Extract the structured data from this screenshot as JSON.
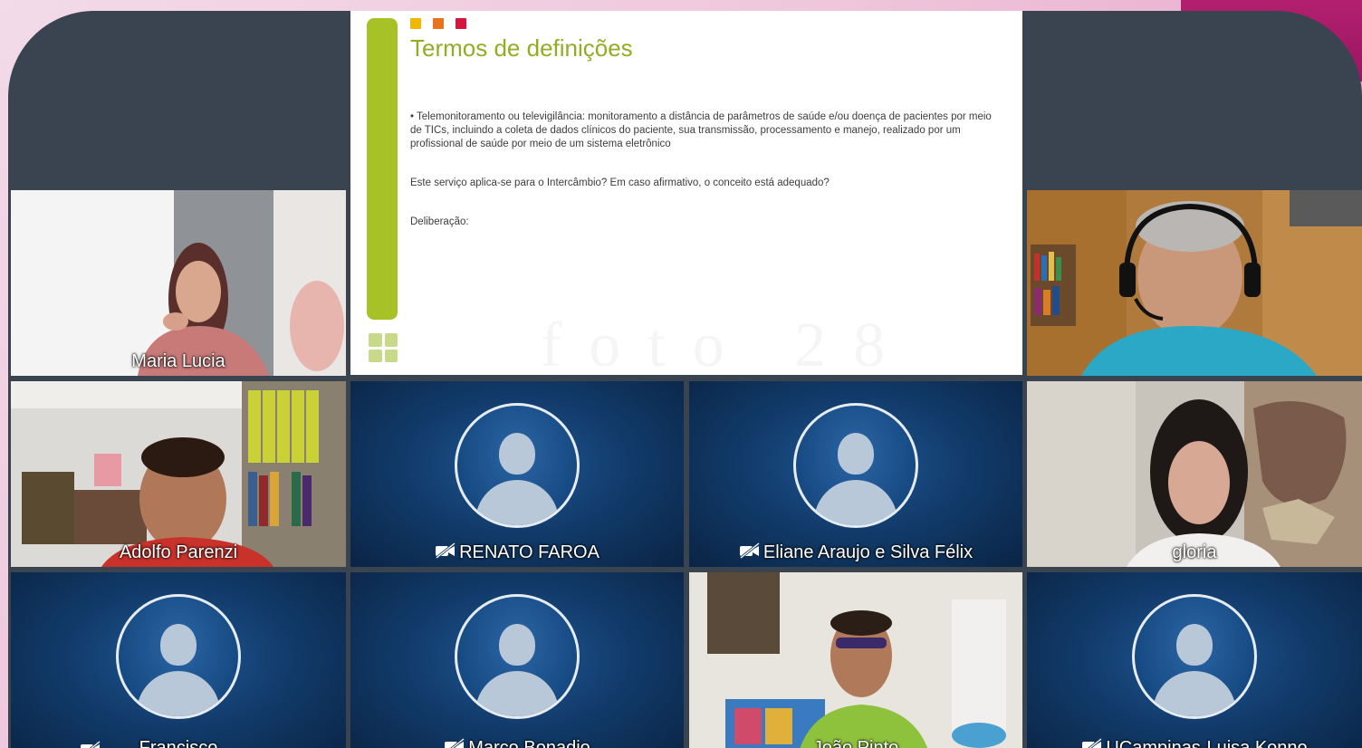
{
  "slide": {
    "title": "Termos de definições",
    "bullet": "• Telemonitoramento ou televigilância: monitoramento a distância de parâmetros de saúde e/ou doença de pacientes por meio de TICs, incluindo a coleta de dados clínicos do paciente, sua transmissão, processamento e manejo, realizado por um profissional de saúde por meio de um sistema eletrônico",
    "question": "Este serviço aplica-se para o Intercâmbio? Em caso afirmativo, o conceito está adequado?",
    "deliberation": "Deliberação:",
    "watermark": "foto 28",
    "dot_colors": [
      "#f2b705",
      "#e8731c",
      "#d6163f"
    ],
    "accent": "#a6c226"
  },
  "participants": [
    {
      "name": "Maria Lucia",
      "video": true,
      "muted": false,
      "active": true
    },
    {
      "name": "Adolfo Parenzi",
      "video": true,
      "muted": false
    },
    {
      "name": "RENATO FAROA",
      "video": false,
      "muted": true
    },
    {
      "name": "Eliane Araujo e Silva Félix",
      "video": false,
      "muted": true
    },
    {
      "name": "gloria",
      "video": true,
      "muted": false
    },
    {
      "name": "Francisco",
      "video": false,
      "muted": true
    },
    {
      "name": "Marco Bonadio",
      "video": false,
      "muted": true
    },
    {
      "name": "João Pinto",
      "video": true,
      "muted": false
    },
    {
      "name": "UCampinas-Luisa Konno",
      "video": false,
      "muted": true
    },
    {
      "name": "",
      "video": true,
      "muted": false,
      "note": "headset participant (no label shown)"
    }
  ],
  "colors": {
    "active_border": "#2d7cf6",
    "tile_bg": "#123c6c",
    "frame_bg": "#3a4350"
  }
}
